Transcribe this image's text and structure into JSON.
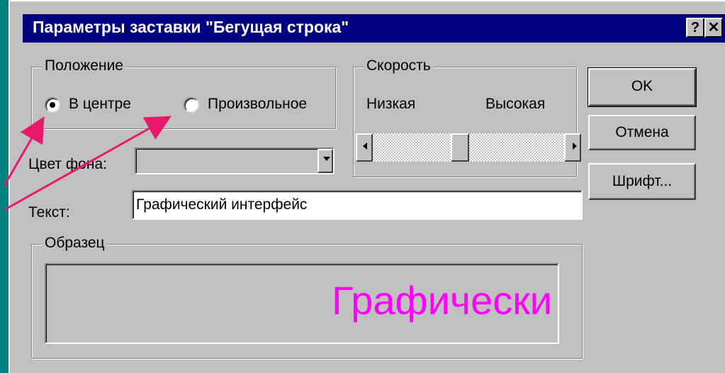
{
  "window": {
    "title": "Параметры заставки \"Бегущая строка\"",
    "help_glyph": "?",
    "close_glyph": "✕"
  },
  "position_group": {
    "legend": "Положение",
    "options": [
      {
        "label": "В центре",
        "selected": true
      },
      {
        "label": "Произвольное",
        "selected": false
      }
    ]
  },
  "speed_group": {
    "legend": "Скорость",
    "low_label": "Низкая",
    "high_label": "Высокая",
    "slider_level": 0.45
  },
  "background_color": {
    "label": "Цвет фона:",
    "value": ""
  },
  "text_field": {
    "label": "Текст:",
    "value": "Графический интерфейс"
  },
  "sample_group": {
    "legend": "Образец",
    "preview_text": "Графически",
    "preview_color": "#ff00ff"
  },
  "buttons": {
    "ok": "OK",
    "cancel": "Отмена",
    "font": "Шрифт..."
  },
  "colors": {
    "desktop": "#008080",
    "titlebar": "#000080",
    "dialog": "#c0c0c0",
    "arrow": "#e8186c"
  }
}
